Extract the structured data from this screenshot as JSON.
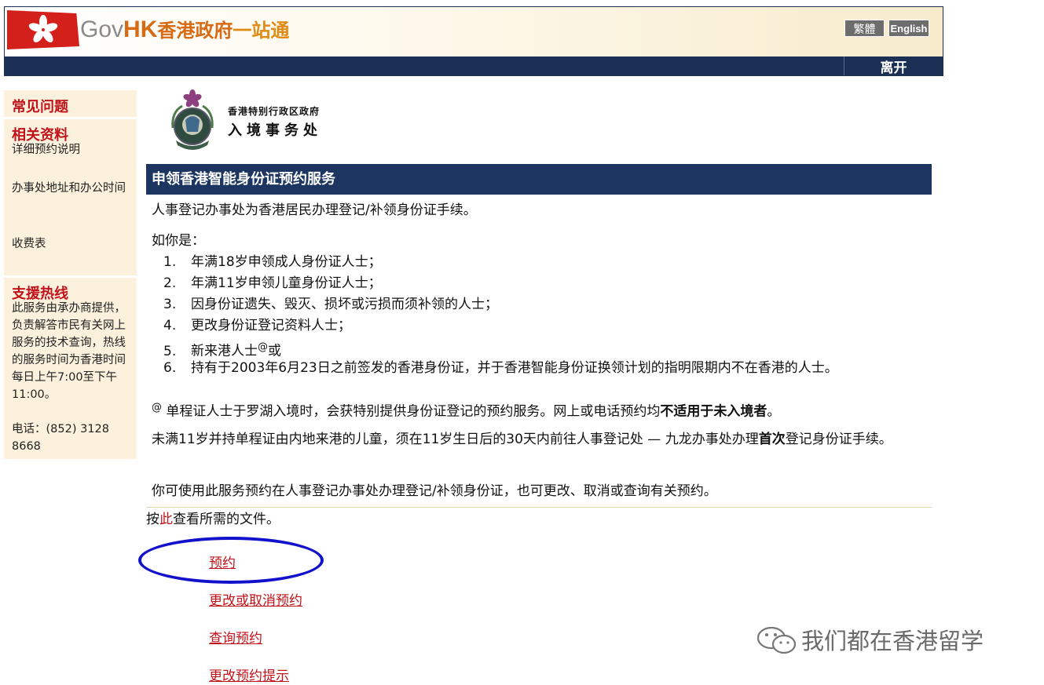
{
  "header": {
    "logo_gov": "Gov",
    "logo_hk": "HK",
    "logo_cn1": "香港政府",
    "logo_cn2": "一站通",
    "lang_traditional": "繁體",
    "lang_english": "English",
    "exit": "离开"
  },
  "sidebar": {
    "faq": "常见问题",
    "related_head": "相关资料",
    "related_items": [
      "详细预约说明",
      "办事处地址和办公时间",
      "收费表"
    ],
    "hotline_head": "支援热线",
    "hotline_desc": "此服务由承办商提供，负责解答市民有关网上服务的技术查询，热线的服务时间为香港时间每日上午7:00至下午11:00。",
    "phone": "电话：(852) 3128 8668"
  },
  "department": {
    "line1": "香港特别行政区政府",
    "line2": "入境事务处"
  },
  "main": {
    "section_title": "申领香港智能身份证预约服务",
    "intro": "人事登记办事处为香港居民办理登记/补领身份证手续。",
    "if_you_are": "如你是：",
    "items": [
      "年满18岁申领成人身份证人士；",
      "年满11岁申领儿童身份证人士；",
      "因身份证遗失、毁灭、损坏或污损而须补领的人士；",
      "更改身份证登记资料人士；",
      "新来港人士",
      "持有于2003年6月23日之前签发的香港身份证，并于香港智能身份证换领计划的指明限期内不在香港的人士。"
    ],
    "item5_sup": "@",
    "item5_tail": "或",
    "note_sup": "@",
    "note_text": " 单程证人士于罗湖入境时，会获特别提供身份证登记的预约服务。网上或电话预约均",
    "note_bold": "不适用于未入境者",
    "note_end": "。",
    "child_text1": "未满11岁并持单程证由内地来港的儿童，须在11岁生日后的30天内前往人事登记处 — 九龙办事处办理",
    "child_bold": "首次",
    "child_text2": "登记身份证手续。",
    "service_text": "你可使用此服务预约在人事登记办事处办理登记/补领身份证，也可更改、取消或查询有关预约。",
    "docs_pre": "按",
    "docs_link": "此",
    "docs_post": "查看所需的文件。"
  },
  "actions": {
    "appointment": "预约",
    "change_cancel": "更改或取消预约",
    "enquire": "查询预约",
    "reminder": "更改预约提示"
  },
  "watermark": "我们都在香港留学",
  "colors": {
    "navy": "#1c2f55",
    "accent_red": "#c1121a",
    "sidebar_bg": "#fbf1dc",
    "annotation_blue": "#1212cc"
  }
}
